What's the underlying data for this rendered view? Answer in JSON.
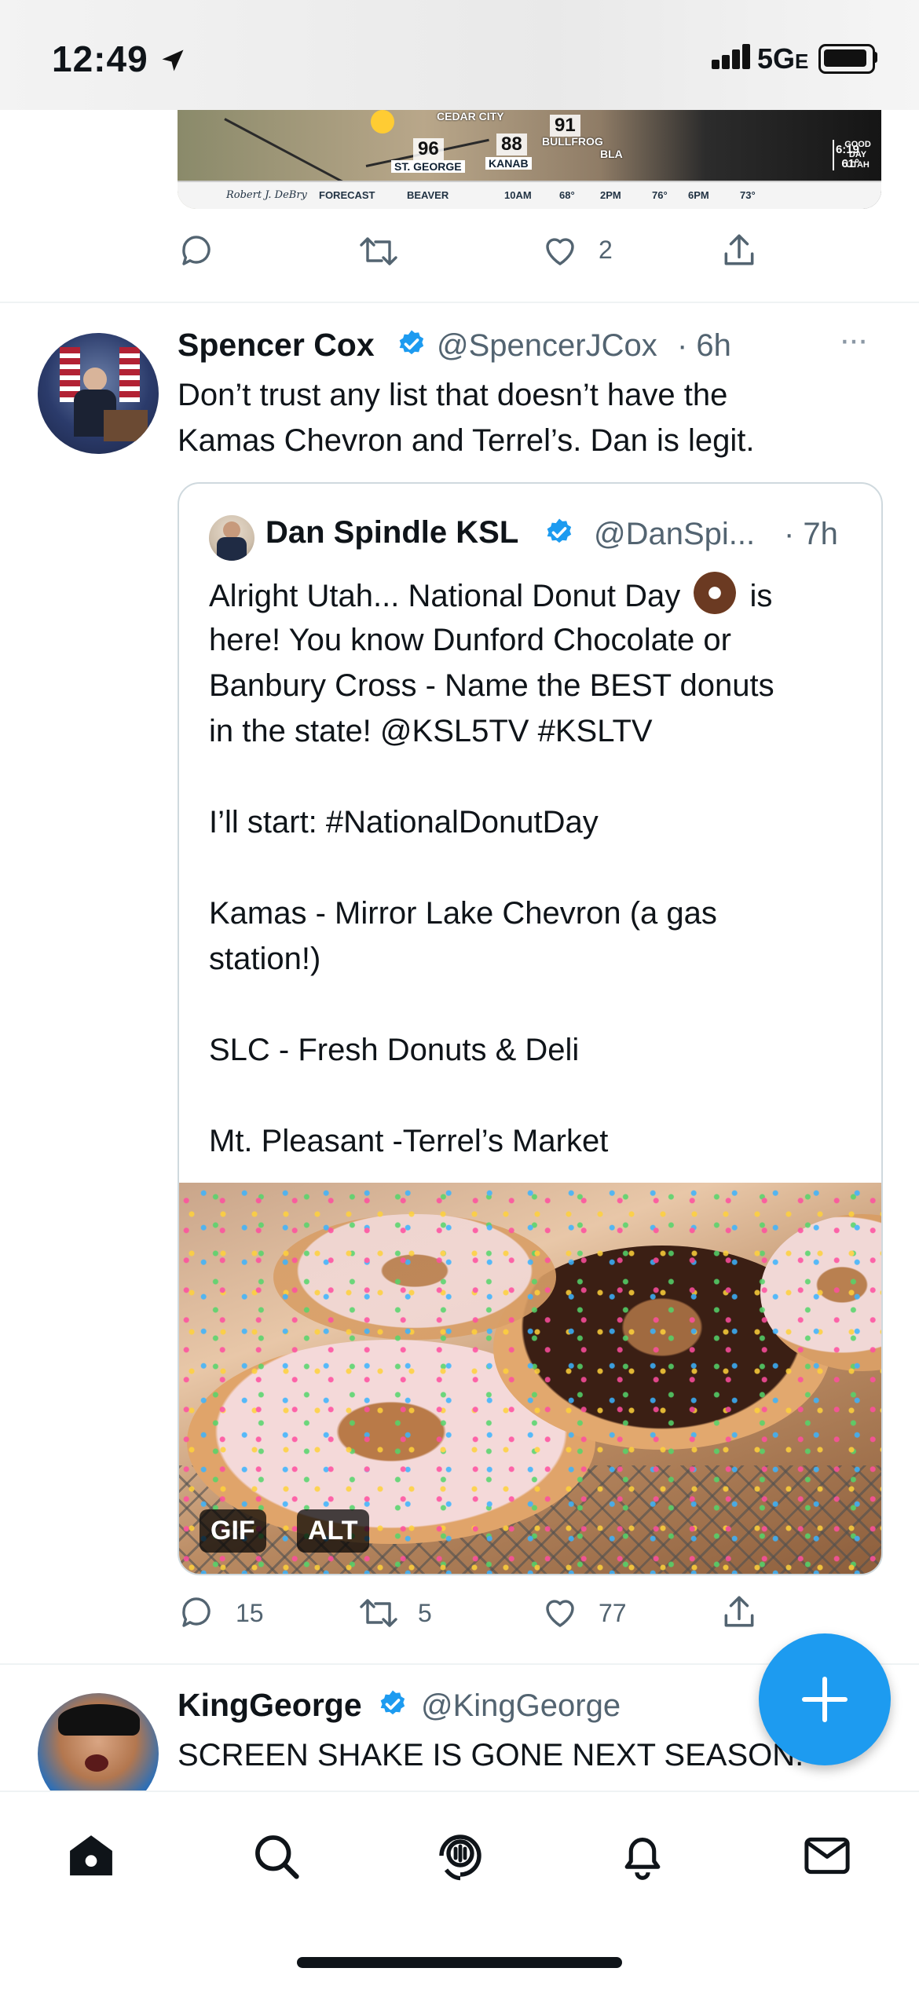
{
  "status_bar": {
    "time": "12:49",
    "network": "5G",
    "network_suffix": "E"
  },
  "weather_card": {
    "city1": "CEDAR CITY",
    "temp1": "96",
    "city2": "ST. GEORGE",
    "temp2": "88",
    "city3": "KANAB",
    "temp3": "91",
    "city4": "BULLFROG",
    "city5": "BLA",
    "bar_brand": "Robert J. DeBry",
    "bar_forecast": "FORECAST",
    "bar_beaver": "BEAVER",
    "t1": "10AM",
    "v1": "68°",
    "t2": "2PM",
    "v2": "76°",
    "t3": "6PM",
    "v3": "73°",
    "clock": "6:19",
    "clock_temp": "61°",
    "show_line1": "GOOD",
    "show_line2": "DAY",
    "show_line3": "UTAH"
  },
  "prev_actions": {
    "likes": "2"
  },
  "tweet": {
    "name": "Spencer Cox",
    "handle": "@SpencerJCox",
    "time": "· 6h",
    "text_line1": "Don’t trust any list that doesn’t have the",
    "text_line2": "Kamas Chevron and Terrel’s. Dan is legit.",
    "more": "···",
    "actions": {
      "replies": "15",
      "retweets": "5",
      "likes": "77"
    }
  },
  "quote": {
    "name": "Dan Spindle KSL",
    "handle": "@DanSpi...",
    "time": "· 7h",
    "text_line1a": "Alright Utah... National Donut Day",
    "text_line1b": "is",
    "text_rest": "here! You know Dunford Chocolate or\nBanbury Cross - Name the BEST donuts\nin the state! @KSL5TV #KSLTV\n\nI’ll start: #NationalDonutDay\n\nKamas - Mirror Lake Chevron (a gas\nstation!)\n\nSLC - Fresh Donuts & Deli\n\nMt. Pleasant -Terrel’s Market",
    "badge_gif": "GIF",
    "badge_alt": "ALT"
  },
  "next_tweet": {
    "name": "KingGeorge",
    "handle": "@KingGeorge",
    "text": "SCREEN SHAKE IS GONE NEXT SEASON."
  },
  "colors": {
    "accent": "#1d9bf0",
    "text": "#0f1419",
    "muted": "#536471"
  },
  "tab_icons": [
    "home-icon",
    "search-icon",
    "spaces-icon",
    "notifications-icon",
    "messages-icon"
  ]
}
